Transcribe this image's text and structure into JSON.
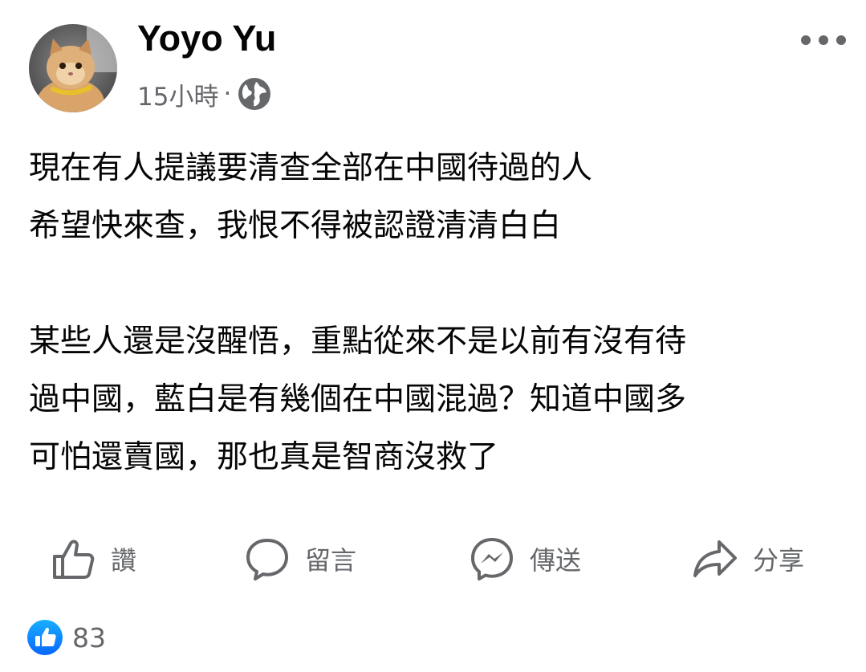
{
  "author": {
    "name": "Yoyo Yu",
    "time": "15小時",
    "separator": "·",
    "privacy_icon": "globe-icon"
  },
  "header": {
    "more_icon": "more-dots-icon"
  },
  "post": {
    "lines": [
      "現在有人提議要清查全部在中國待過的人",
      "希望快來查，我恨不得被認證清清白白",
      "",
      "某些人還是沒醒悟，重點從來不是以前有沒有待",
      "過中國，藍白是有幾個在中國混過？知道中國多",
      "可怕還賣國，那也真是智商沒救了"
    ]
  },
  "actions": {
    "like": {
      "label": "讚",
      "icon": "thumbs-up-icon"
    },
    "comment": {
      "label": "留言",
      "icon": "comment-bubble-icon"
    },
    "send": {
      "label": "傳送",
      "icon": "messenger-icon"
    },
    "share": {
      "label": "分享",
      "icon": "share-arrow-icon"
    }
  },
  "reactions": {
    "count": "83",
    "icon": "like-badge-icon"
  },
  "colors": {
    "text_primary": "#050505",
    "text_secondary": "#65676b",
    "like_blue": "#1877f2"
  }
}
